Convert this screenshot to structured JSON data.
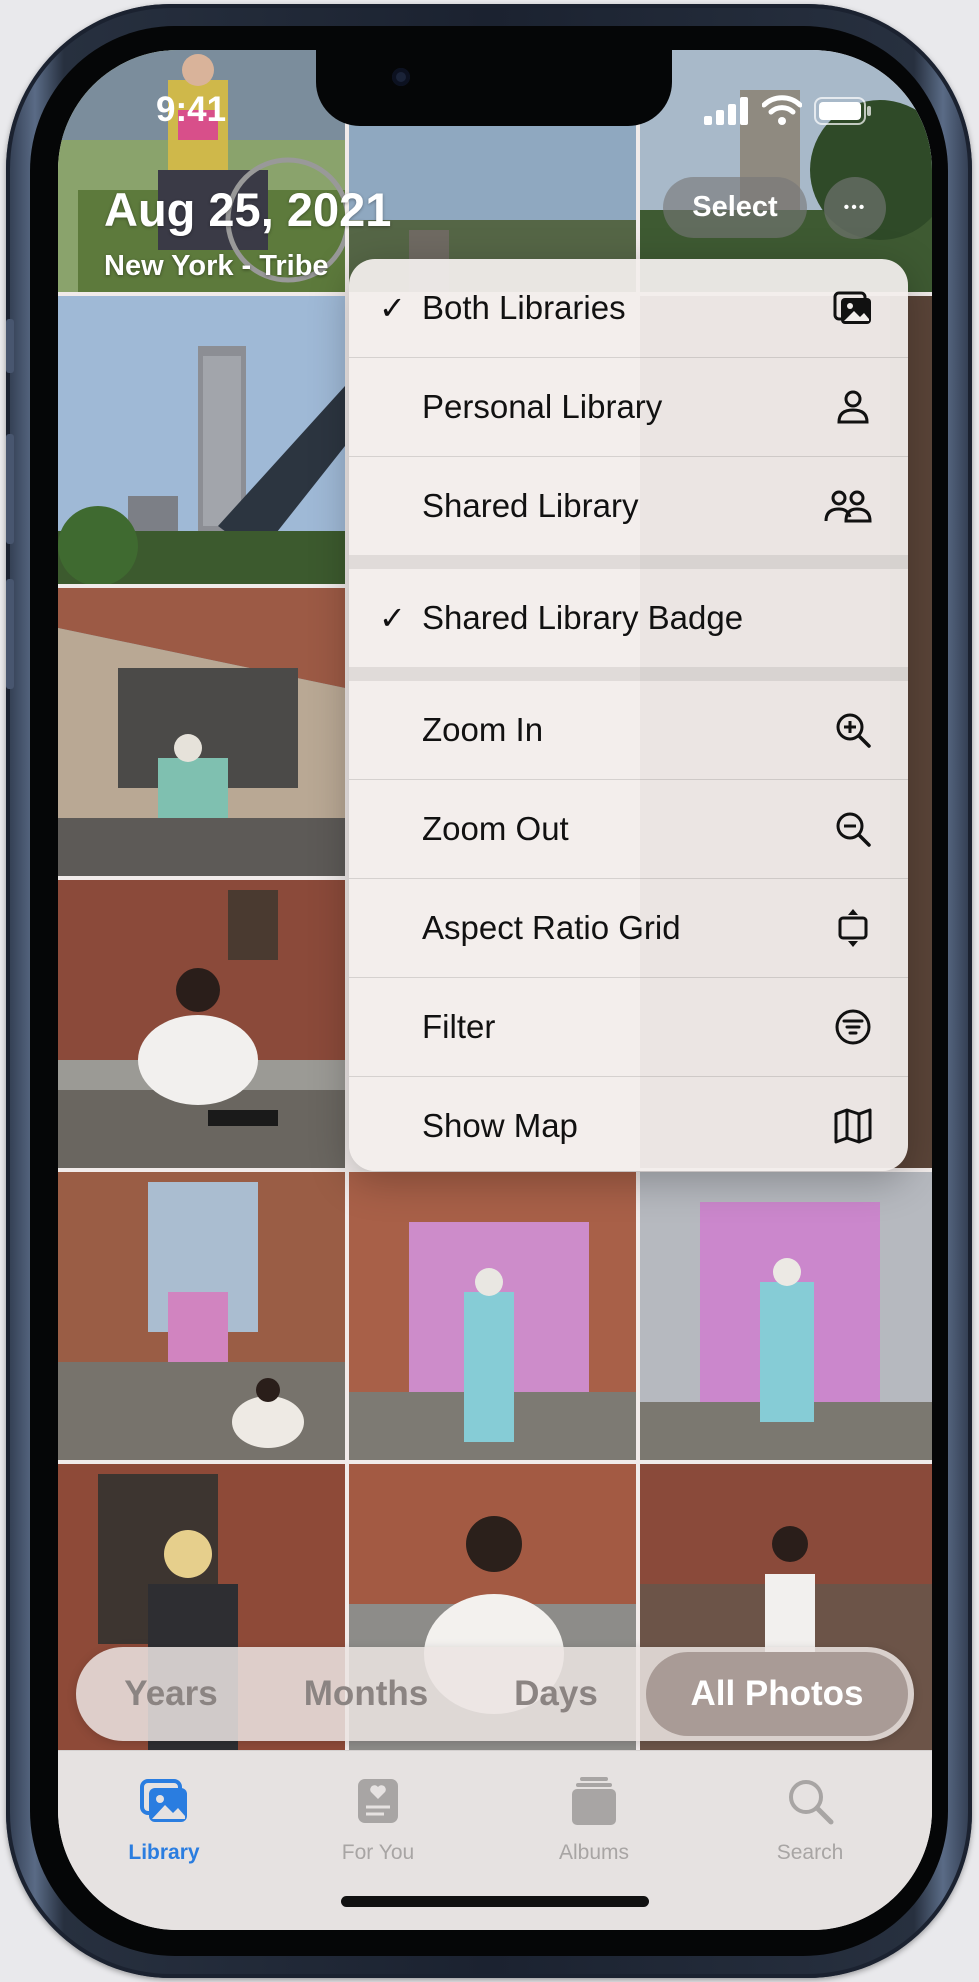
{
  "status_bar": {
    "time": "9:41"
  },
  "header": {
    "date": "Aug 25, 2021",
    "location": "New York - Tribe",
    "select_label": "Select",
    "more_label": "•••"
  },
  "menu": {
    "items": [
      {
        "label": "Both Libraries",
        "checked": true,
        "icon": "photo-library-icon"
      },
      {
        "label": "Personal Library",
        "checked": false,
        "icon": "person-icon"
      },
      {
        "label": "Shared Library",
        "checked": false,
        "icon": "two-people-icon"
      },
      {
        "label": "Shared Library Badge",
        "checked": true,
        "icon": ""
      },
      {
        "label": "Zoom In",
        "checked": false,
        "icon": "zoom-in-icon"
      },
      {
        "label": "Zoom Out",
        "checked": false,
        "icon": "zoom-out-icon"
      },
      {
        "label": "Aspect Ratio Grid",
        "checked": false,
        "icon": "aspect-ratio-icon"
      },
      {
        "label": "Filter",
        "checked": false,
        "icon": "filter-icon"
      },
      {
        "label": "Show Map",
        "checked": false,
        "icon": "map-icon"
      }
    ],
    "check_glyph": "✓"
  },
  "segmented": {
    "options": [
      "Years",
      "Months",
      "Days",
      "All Photos"
    ],
    "selected": "All Photos"
  },
  "tabbar": {
    "tabs": [
      {
        "label": "Library",
        "icon": "library-icon",
        "active": true
      },
      {
        "label": "For You",
        "icon": "for-you-icon",
        "active": false
      },
      {
        "label": "Albums",
        "icon": "albums-icon",
        "active": false
      },
      {
        "label": "Search",
        "icon": "search-icon",
        "active": false
      }
    ]
  },
  "colors": {
    "accent": "#2a7de0",
    "menu_bg": "#f2eeec",
    "segment_active": "#a99b96"
  }
}
